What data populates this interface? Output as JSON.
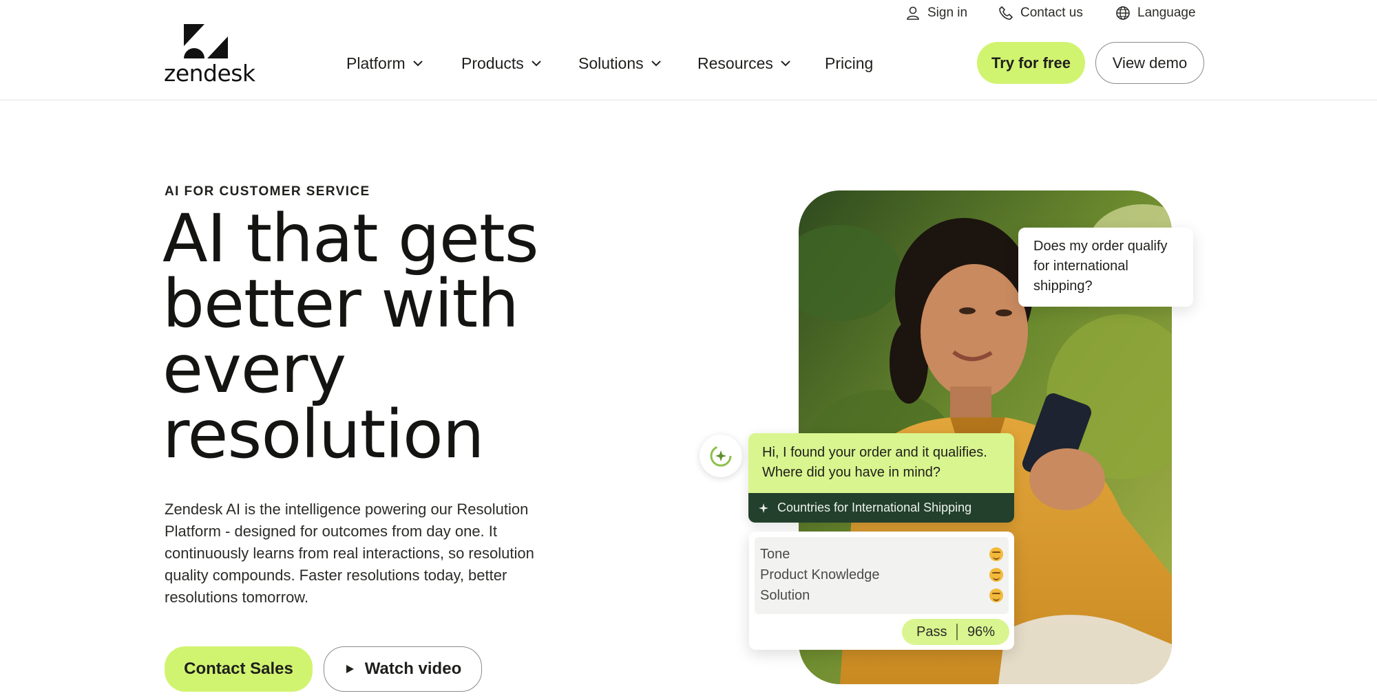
{
  "brand": {
    "name": "zendesk",
    "accent": "#d1f470",
    "dark_green": "#23402c"
  },
  "utility_nav": {
    "sign_in": "Sign in",
    "contact_us": "Contact us",
    "language": "Language"
  },
  "main_nav": {
    "items": [
      {
        "label": "Platform",
        "has_dropdown": true
      },
      {
        "label": "Products",
        "has_dropdown": true
      },
      {
        "label": "Solutions",
        "has_dropdown": true
      },
      {
        "label": "Resources",
        "has_dropdown": true
      },
      {
        "label": "Pricing",
        "has_dropdown": false
      }
    ],
    "try_label": "Try for free",
    "demo_label": "View demo"
  },
  "hero": {
    "eyebrow": "AI FOR CUSTOMER SERVICE",
    "headline": "AI that gets better with every resolution",
    "body": "Zendesk AI is the intelligence powering our Resolution Platform - designed for outcomes from day one. It continuously learns from real interactions, so resolution quality compounds. Faster resolutions today, better resolutions tomorrow.",
    "primary_cta": "Contact Sales",
    "secondary_cta": "Watch video"
  },
  "visual": {
    "customer_question": "Does my order qualify for international shipping?",
    "ai_reply": "Hi, I found your order and it qualifies. Where did you have in mind?",
    "source": "Countries for International Shipping",
    "scores": [
      {
        "label": "Tone",
        "icon": "smile-emoji-icon"
      },
      {
        "label": "Product Knowledge",
        "icon": "smile-emoji-icon"
      },
      {
        "label": "Solution",
        "icon": "smile-emoji-icon"
      }
    ],
    "result": "Pass",
    "score": "96%"
  }
}
